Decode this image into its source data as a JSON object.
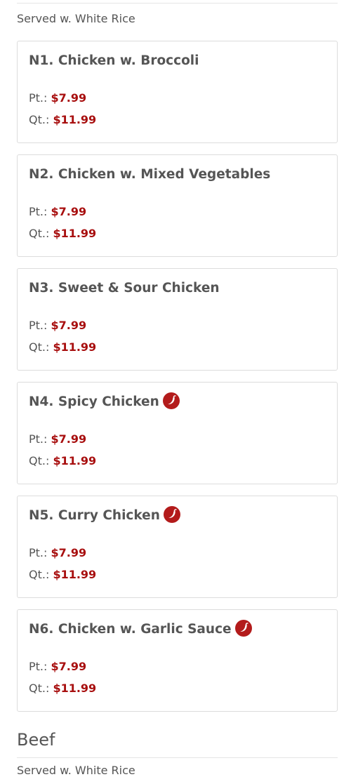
{
  "chicken_section": {
    "note": "Served w. White Rice"
  },
  "colors": {
    "price": "#a80f0f",
    "spicy_icon": "#b31b1b",
    "text": "#555555",
    "card_border": "#dcdcdc"
  },
  "items": [
    {
      "title": "N1. Chicken w. Broccoli",
      "spicy": false,
      "pt_label": "Pt.:",
      "pt_price": "$7.99",
      "qt_label": "Qt.:",
      "qt_price": "$11.99"
    },
    {
      "title": "N2. Chicken w. Mixed Vegetables",
      "spicy": false,
      "pt_label": "Pt.:",
      "pt_price": "$7.99",
      "qt_label": "Qt.:",
      "qt_price": "$11.99"
    },
    {
      "title": "N3. Sweet & Sour Chicken",
      "spicy": false,
      "pt_label": "Pt.:",
      "pt_price": "$7.99",
      "qt_label": "Qt.:",
      "qt_price": "$11.99"
    },
    {
      "title": "N4. Spicy Chicken",
      "spicy": true,
      "pt_label": "Pt.:",
      "pt_price": "$7.99",
      "qt_label": "Qt.:",
      "qt_price": "$11.99"
    },
    {
      "title": "N5. Curry Chicken",
      "spicy": true,
      "pt_label": "Pt.:",
      "pt_price": "$7.99",
      "qt_label": "Qt.:",
      "qt_price": "$11.99"
    },
    {
      "title": "N6. Chicken w. Garlic Sauce",
      "spicy": true,
      "pt_label": "Pt.:",
      "pt_price": "$7.99",
      "qt_label": "Qt.:",
      "qt_price": "$11.99"
    }
  ],
  "beef_section": {
    "title": "Beef",
    "note": "Served w. White Rice"
  },
  "icons": {
    "spicy": "chili-pepper-icon"
  }
}
